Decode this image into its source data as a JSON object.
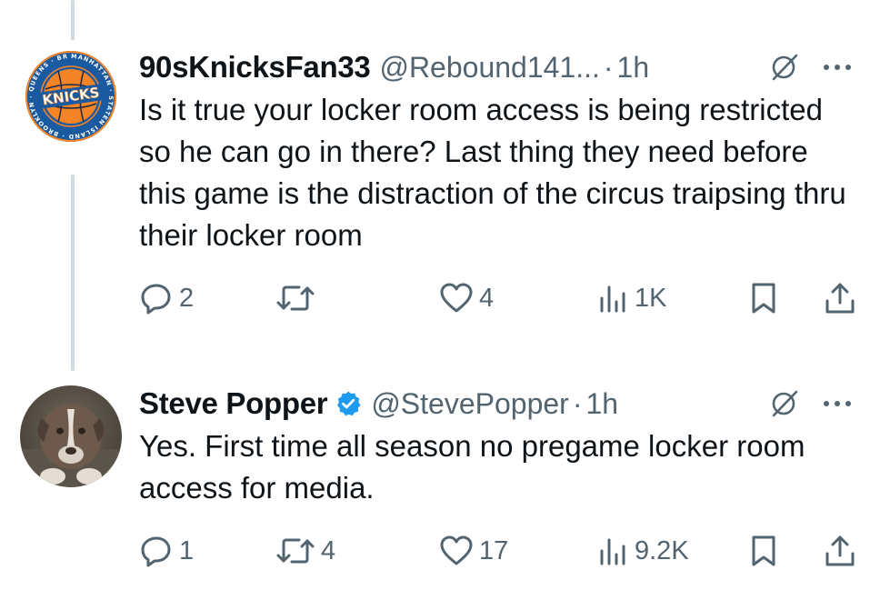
{
  "tweets": [
    {
      "display_name": "90sKnicksFan33",
      "handle": "@Rebound141...",
      "separator": "·",
      "time": "1h",
      "verified": false,
      "text": "Is it true your locker room access is being restricted so he can go in there? Last thing they need before this game is the distraction of the circus traipsing thru their locker room",
      "avatar_icon": "knicks-logo-avatar",
      "avatar_ring_text": "MANHATTAN · STATEN ISLAND · BROOKLYN · QUEENS · BRONX",
      "avatar_center_text": "KNICKS",
      "replies": "2",
      "retweets": "",
      "likes": "4",
      "views": "1K"
    },
    {
      "display_name": "Steve Popper",
      "handle": "@StevePopper",
      "separator": "·",
      "time": "1h",
      "verified": true,
      "text": "Yes. First time all season no pregame locker room access for media.",
      "avatar_icon": "dog-photo-avatar",
      "replies": "1",
      "retweets": "4",
      "likes": "17",
      "views": "9.2K"
    }
  ],
  "icons": {
    "reply": "reply-icon",
    "retweet": "retweet-icon",
    "like": "heart-icon",
    "views": "views-chart-icon",
    "bookmark": "bookmark-icon",
    "share": "share-icon",
    "grok": "grok-icon",
    "more": "more-icon",
    "verified": "verified-badge-icon"
  },
  "colors": {
    "text_primary": "#0f1419",
    "text_secondary": "#536471",
    "verified_blue": "#1d9bf0",
    "thread_line": "#cfd9de",
    "knicks_orange": "#f58426",
    "knicks_blue": "#006bb6"
  }
}
